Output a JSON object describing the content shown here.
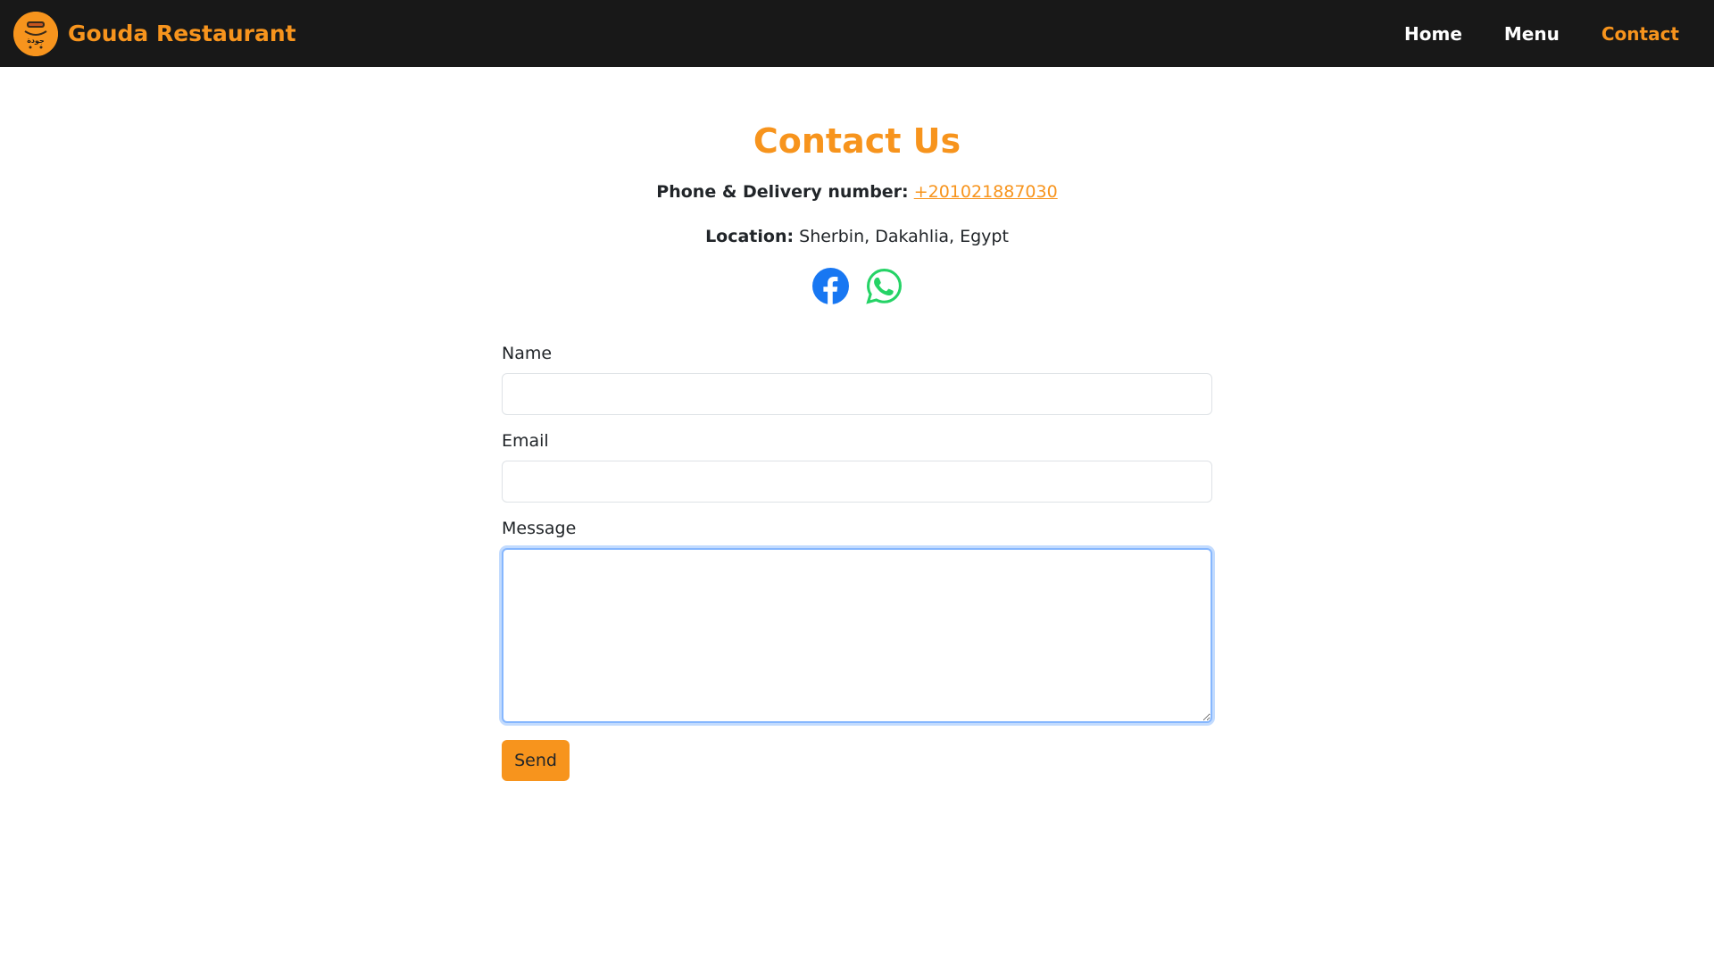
{
  "navbar": {
    "brand_name": "Gouda Restaurant",
    "logo_icon": "restaurant-logo-icon",
    "links": [
      {
        "label": "Home",
        "active": false
      },
      {
        "label": "Menu",
        "active": false
      },
      {
        "label": "Contact",
        "active": true
      }
    ]
  },
  "contact": {
    "title": "Contact Us",
    "phone_label": "Phone & Delivery number:",
    "phone_value": "+201021887030",
    "location_label": "Location:",
    "location_value": "Sherbin, Dakahlia, Egypt",
    "socials": [
      {
        "icon": "facebook-icon",
        "color": "#1877f2"
      },
      {
        "icon": "whatsapp-icon",
        "color": "#25d366"
      }
    ]
  },
  "form": {
    "name_label": "Name",
    "name_value": "",
    "email_label": "Email",
    "email_value": "",
    "message_label": "Message",
    "message_value": "",
    "send_label": "Send"
  },
  "colors": {
    "accent": "#f7941d",
    "navbar_bg": "#181818",
    "focus_border": "#86b7fe"
  }
}
